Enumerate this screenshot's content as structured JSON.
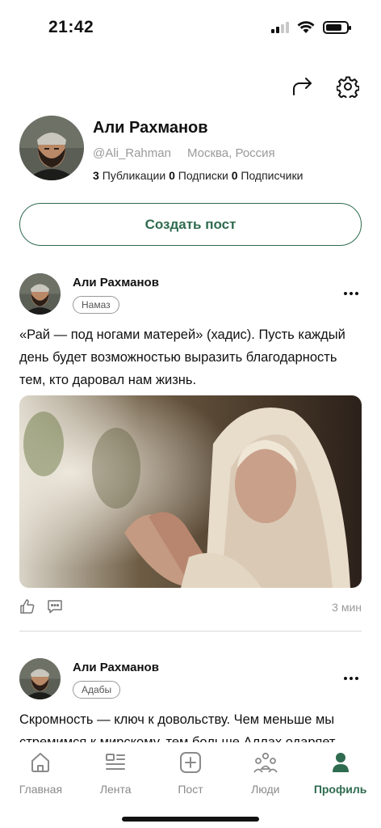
{
  "status_bar": {
    "time": "21:42"
  },
  "profile": {
    "name": "Али Рахманов",
    "username": "@Ali_Rahman",
    "location": "Москва, Россия",
    "stats": {
      "posts_count": "3",
      "posts_label": "Публикации",
      "following_count": "0",
      "following_label": "Подписки",
      "followers_count": "0",
      "followers_label": "Подписчики"
    }
  },
  "create_post_label": "Создать пост",
  "posts": [
    {
      "author": "Али Рахманов",
      "tag": "Намаз",
      "text": "«Рай — под ногами матерей» (хадис). Пусть каждый день будет возможностью выразить благодарность тем, кто даровал нам жизнь.",
      "time": "3 мин"
    },
    {
      "author": "Али Рахманов",
      "tag": "Адабы",
      "text": "Скромность — ключ к довольству. Чем меньше мы стремимся к мирскому, тем больше Аллах одаряет"
    }
  ],
  "nav": {
    "items": [
      {
        "label": "Главная",
        "icon": "home-icon"
      },
      {
        "label": "Лента",
        "icon": "feed-icon"
      },
      {
        "label": "Пост",
        "icon": "add-post-icon"
      },
      {
        "label": "Люди",
        "icon": "people-icon"
      },
      {
        "label": "Профиль",
        "icon": "profile-icon"
      }
    ],
    "active": "Профиль"
  },
  "colors": {
    "accent": "#2f6b4f",
    "muted": "#9a9a9a"
  }
}
